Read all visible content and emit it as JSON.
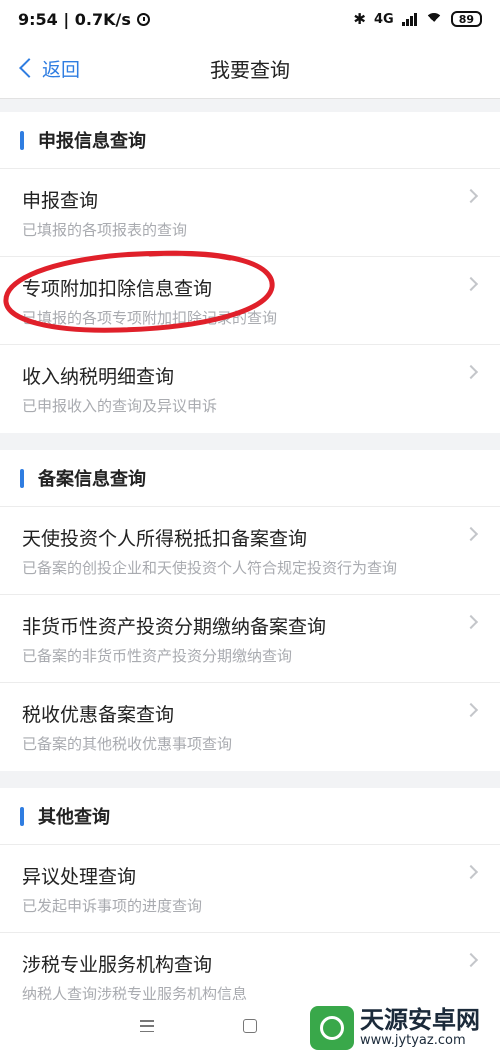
{
  "status_bar": {
    "time_speed": "9:54 | 0.7K/s",
    "network": "4G",
    "battery": "89"
  },
  "header": {
    "back_label": "返回",
    "title": "我要查询"
  },
  "sections": [
    {
      "title": "申报信息查询",
      "items": [
        {
          "title": "申报查询",
          "subtitle": "已填报的各项报表的查询"
        },
        {
          "title": "专项附加扣除信息查询",
          "subtitle": "已填报的各项专项附加扣除记录的查询"
        },
        {
          "title": "收入纳税明细查询",
          "subtitle": "已申报收入的查询及异议申诉"
        }
      ]
    },
    {
      "title": "备案信息查询",
      "items": [
        {
          "title": "天使投资个人所得税抵扣备案查询",
          "subtitle": "已备案的创投企业和天使投资个人符合规定投资行为查询"
        },
        {
          "title": "非货币性资产投资分期缴纳备案查询",
          "subtitle": "已备案的非货币性资产投资分期缴纳查询"
        },
        {
          "title": "税收优惠备案查询",
          "subtitle": "已备案的其他税收优惠事项查询"
        }
      ]
    },
    {
      "title": "其他查询",
      "items": [
        {
          "title": "异议处理查询",
          "subtitle": "已发起申诉事项的进度查询"
        },
        {
          "title": "涉税专业服务机构查询",
          "subtitle": "纳税人查询涉税专业服务机构信息"
        }
      ]
    }
  ],
  "watermark": {
    "name": "天源安卓网",
    "url": "www.jytyaz.com"
  },
  "colors": {
    "accent": "#2f7de1",
    "annotation": "#e0202a"
  }
}
